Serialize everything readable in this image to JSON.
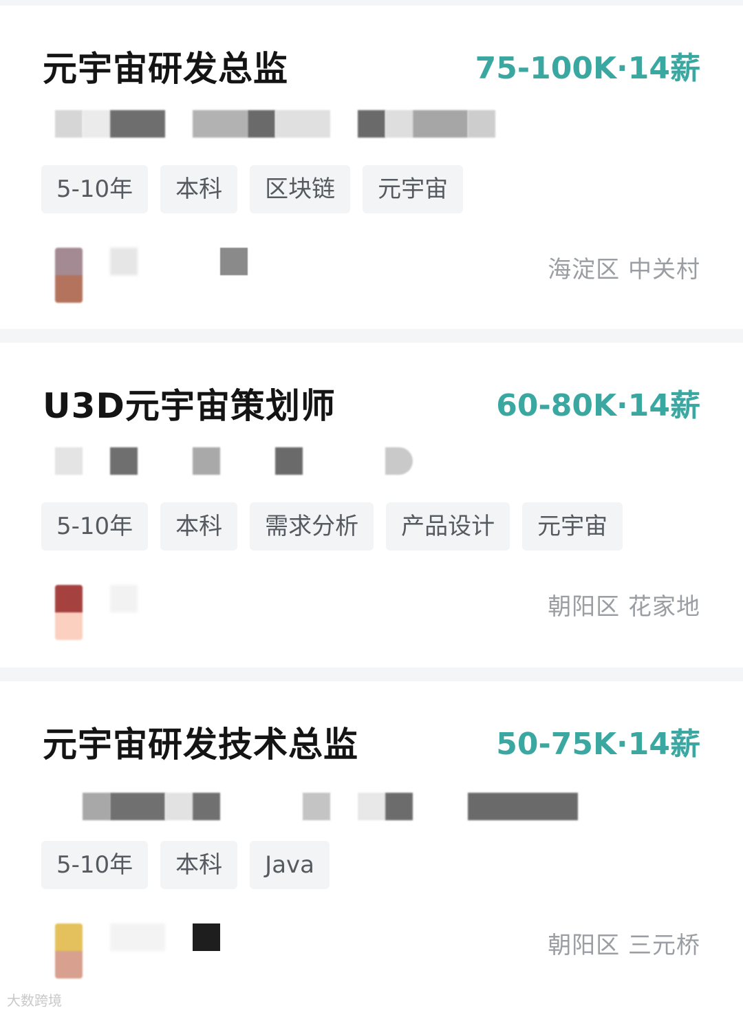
{
  "jobs": [
    {
      "title": "元宇宙研发总监",
      "salary": "75-100K·14薪",
      "tags": [
        "5-10年",
        "本科",
        "区块链",
        "元宇宙"
      ],
      "location": "海淀区 中关村"
    },
    {
      "title": "U3D元宇宙策划师",
      "salary": "60-80K·14薪",
      "tags": [
        "5-10年",
        "本科",
        "需求分析",
        "产品设计",
        "元宇宙"
      ],
      "location": "朝阳区 花家地"
    },
    {
      "title": "元宇宙研发技术总监",
      "salary": "50-75K·14薪",
      "tags": [
        "5-10年",
        "本科",
        "Java"
      ],
      "location": "朝阳区 三元桥"
    }
  ],
  "watermark": "大数跨境",
  "colors": {
    "salary": "#3aa7a0",
    "title": "#141414",
    "tag_bg": "#f3f4f5",
    "location": "#9a9ea3"
  }
}
